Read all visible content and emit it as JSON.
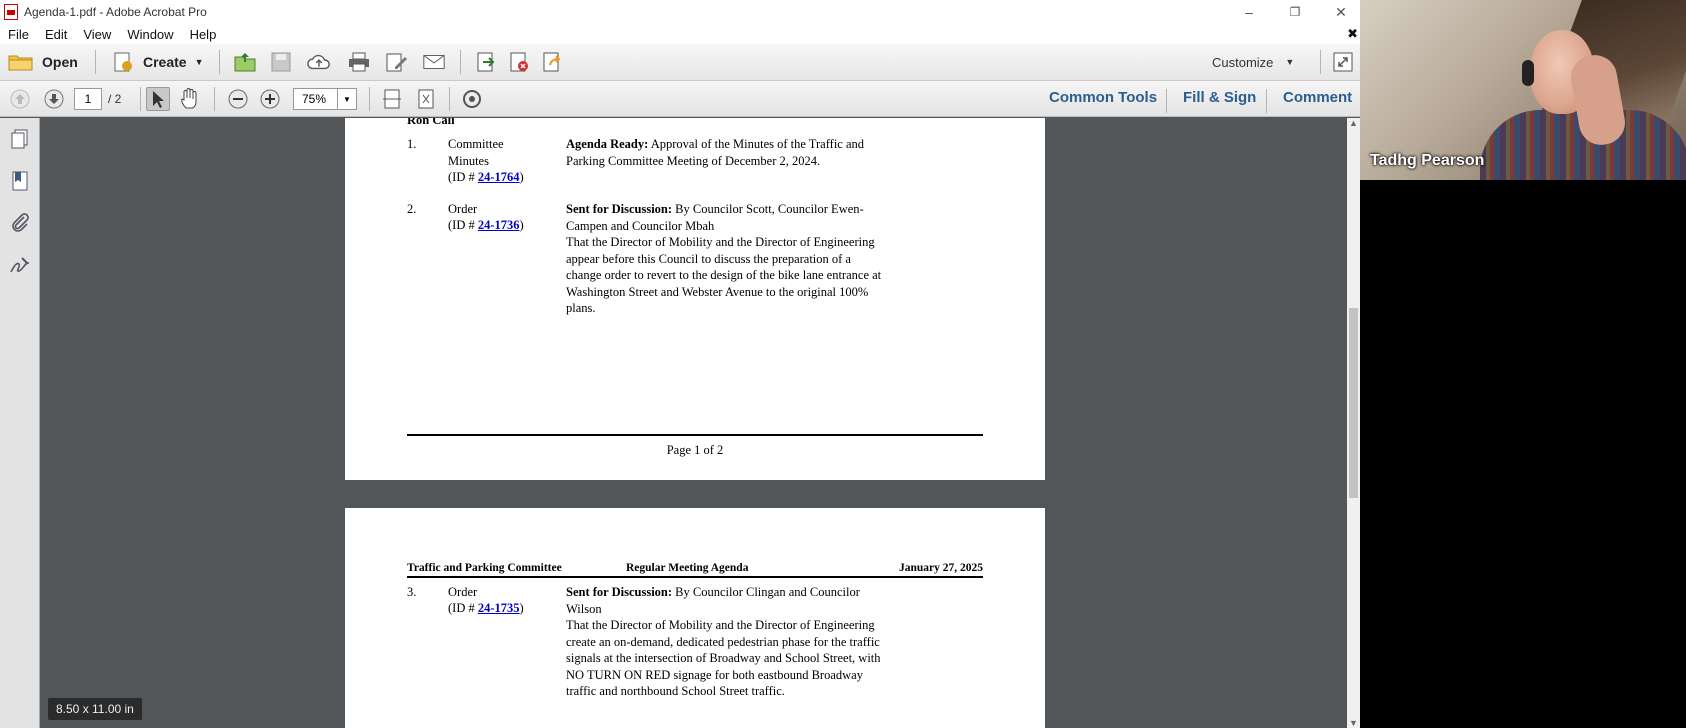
{
  "window": {
    "title": "Agenda-1.pdf - Adobe Acrobat Pro",
    "controls": [
      "–",
      "❐",
      "✕"
    ]
  },
  "menu": [
    "File",
    "Edit",
    "View",
    "Window",
    "Help"
  ],
  "toolbar": {
    "open_label": "Open",
    "create_label": "Create",
    "customize_label": "Customize"
  },
  "nav": {
    "current_page": "1",
    "total_pages": "/ 2",
    "zoom": "75%"
  },
  "panes": [
    "Common Tools",
    "Fill & Sign",
    "Comment"
  ],
  "page1": {
    "header_fragment": "Ron Cali",
    "items": [
      {
        "number": "1.",
        "type": "Committee Minutes",
        "id_prefix": "(ID # ",
        "id": "24-1764",
        "id_suffix": ")",
        "status": "Agenda Ready:",
        "text": "Approval of the Minutes of the Traffic and Parking Committee Meeting of December 2, 2024."
      },
      {
        "number": "2.",
        "type": "Order",
        "id_prefix": "(ID # ",
        "id": "24-1736",
        "id_suffix": ")",
        "status": "Sent for Discussion:",
        "text": "By Councilor Scott, Councilor Ewen-Campen and Councilor Mbah",
        "body": "That the Director of Mobility and the Director of Engineering appear before this Council to discuss the preparation of a change order to revert to the design of the bike lane entrance at Washington Street and Webster Avenue to the original 100% plans."
      }
    ],
    "footer": "Page 1 of 2"
  },
  "page2": {
    "header_left": "Traffic and Parking Committee",
    "header_center": "Regular Meeting Agenda",
    "header_right": "January 27, 2025",
    "items": [
      {
        "number": "3.",
        "type": "Order",
        "id_prefix": "(ID # ",
        "id": "24-1735",
        "id_suffix": ")",
        "status": "Sent for Discussion:",
        "text": "By Councilor Clingan and Councilor Wilson",
        "body": "That the Director of Mobility and the Director of Engineering create an on-demand, dedicated pedestrian phase for the traffic signals at the intersection of Broadway and School Street, with NO TURN ON RED signage for both eastbound Broadway traffic and northbound School Street traffic."
      }
    ]
  },
  "page_size_badge": "8.50 x 11.00 in",
  "video": {
    "participant_name": "Tadhg Pearson"
  }
}
